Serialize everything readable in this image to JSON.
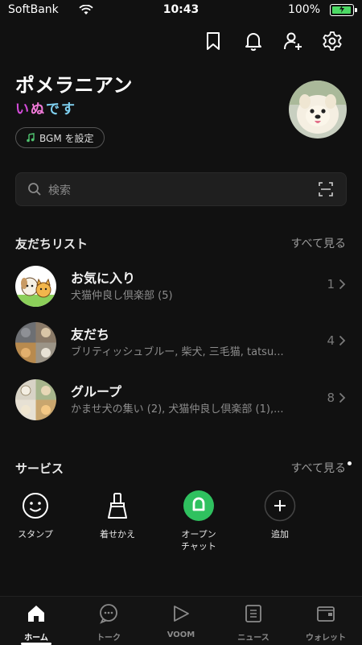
{
  "status_bar": {
    "carrier": "SoftBank",
    "time": "10:43",
    "battery": "100%"
  },
  "profile": {
    "name": "ポメラニアン",
    "status_chars": [
      {
        "ch": "い",
        "color": "#d24bd8"
      },
      {
        "ch": "ぬ",
        "color": "#f07ad8"
      },
      {
        "ch": "で",
        "color": "#7fd0f0"
      },
      {
        "ch": "す",
        "color": "#7fd0f0"
      }
    ],
    "bgm_label": "BGM を設定"
  },
  "search": {
    "placeholder": "検索"
  },
  "friends_section": {
    "title": "友だちリスト",
    "see_all": "すべて見る",
    "rows": [
      {
        "title": "お気に入り",
        "subtitle": "犬猫仲良し倶楽部 (5)",
        "count": "1"
      },
      {
        "title": "友だち",
        "subtitle": "ブリティッシュブルー, 柴犬, 三毛猫, tatsu...",
        "count": "4"
      },
      {
        "title": "グループ",
        "subtitle": "かませ犬の集い (2), 犬猫仲良し倶楽部 (1),...",
        "count": "8"
      }
    ]
  },
  "services_section": {
    "title": "サービス",
    "see_all": "すべて見る",
    "items": [
      {
        "label": "スタンプ",
        "icon": "smiley-icon"
      },
      {
        "label": "着せかえ",
        "icon": "brush-icon"
      },
      {
        "label": "オープン\nチャット",
        "icon": "open-chat-icon"
      },
      {
        "label": "追加",
        "icon": "plus-icon"
      }
    ]
  },
  "tabs": [
    {
      "label": "ホーム",
      "icon": "home-icon",
      "active": true
    },
    {
      "label": "トーク",
      "icon": "chat-icon",
      "active": false
    },
    {
      "label": "VOOM",
      "icon": "voom-icon",
      "active": false
    },
    {
      "label": "ニュース",
      "icon": "news-icon",
      "active": false
    },
    {
      "label": "ウォレット",
      "icon": "wallet-icon",
      "active": false
    }
  ],
  "colors": {
    "background": "#111111",
    "accent_green": "#2fc15f",
    "battery_green": "#4cd964"
  }
}
